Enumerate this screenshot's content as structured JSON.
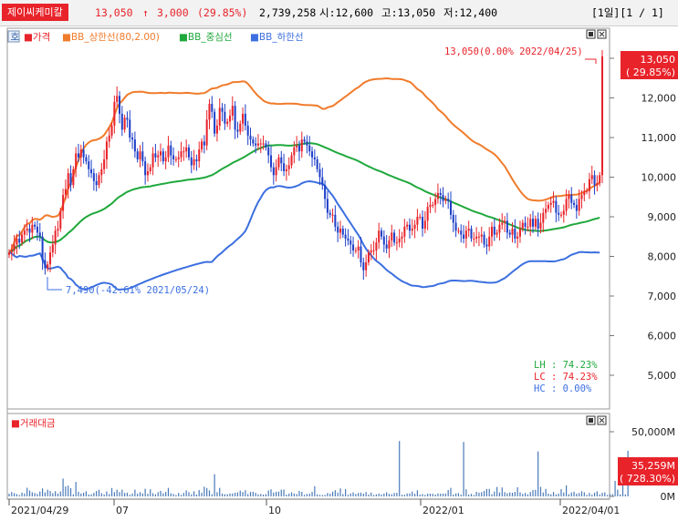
{
  "header": {
    "stock_name": "제이씨케미칼",
    "price": "13,050",
    "change_arrow": "↑",
    "change": "3,000",
    "change_pct": "(29.85%)",
    "volume": "2,739,258",
    "open": "시:12,600",
    "high": "고:13,050",
    "low": "저:12,400",
    "period": "[1일][1 / 1]"
  },
  "legend": {
    "price": "가격",
    "bb_upper": "BB_상한선(80,2.00)",
    "bb_mid": "BB_중심선",
    "bb_lower": "BB_하한선",
    "volume": "거래대금"
  },
  "badges": {
    "price_value": "13,050",
    "price_pct": "( 29.85%)",
    "volume_value": "35,259M",
    "volume_pct": "( 728.30%)"
  },
  "annotations": {
    "high": "13,050(0.00% 2022/04/25)",
    "low": "7,490(-42.61% 2021/05/24)",
    "lh": "LH : 74.23%",
    "lc": "LC : 74.23%",
    "hc": "HC : 0.00%"
  },
  "colors": {
    "up": "#e8232a",
    "down": "#1e3fc8",
    "bb_upper": "#f07b2b",
    "bb_mid": "#1fa83c",
    "bb_lower": "#3c6fe0",
    "volume": "#4a7ab8"
  },
  "chart_data": [
    {
      "type": "candlestick",
      "ylim": [
        4300,
        13500
      ],
      "y_ticks": [
        "13,000",
        "12,000",
        "11,000",
        "10,000",
        "9,000",
        "8,000",
        "7,000",
        "6,000",
        "5,000"
      ],
      "x_ticks": [
        "2021/04/29",
        "07",
        "10",
        "2022/01",
        "2022/04/01"
      ],
      "close": [
        8100,
        8150,
        8300,
        8450,
        8350,
        8550,
        8650,
        8700,
        8600,
        8800,
        8750,
        8600,
        8500,
        7900,
        7700,
        7800,
        8100,
        8300,
        8650,
        8700,
        9150,
        9550,
        9700,
        10100,
        9800,
        10200,
        10600,
        10500,
        10700,
        10500,
        10400,
        10200,
        10100,
        9900,
        9800,
        10050,
        10200,
        10450,
        10900,
        11050,
        11300,
        11900,
        12050,
        11600,
        11200,
        11500,
        11450,
        11000,
        10950,
        10650,
        10450,
        10650,
        10400,
        10050,
        10150,
        10250,
        10600,
        10500,
        10550,
        10650,
        10400,
        10500,
        10800,
        10550,
        10450,
        10450,
        10500,
        10650,
        10650,
        10750,
        10500,
        10300,
        10450,
        10400,
        10700,
        10900,
        10800,
        11450,
        11850,
        11650,
        11100,
        11300,
        11750,
        11650,
        11350,
        11400,
        11550,
        11800,
        11200,
        11150,
        11350,
        11600,
        11300,
        11050,
        10950,
        10850,
        10800,
        10850,
        10850,
        10850,
        10750,
        10550,
        10250,
        10050,
        10250,
        10500,
        10350,
        10150,
        10200,
        10300,
        10550,
        10750,
        10800,
        10650,
        10950,
        10900,
        10800,
        10650,
        10500,
        10450,
        10200,
        10000,
        9800,
        9450,
        9100,
        9050,
        9050,
        8750,
        8600,
        8700,
        8550,
        8450,
        8400,
        8300,
        8150,
        8150,
        8250,
        7850,
        7650,
        7850,
        8100,
        8150,
        8150,
        8350,
        8650,
        8500,
        8300,
        8200,
        8400,
        8600,
        8350,
        8350,
        8450,
        8500,
        8750,
        8800,
        8650,
        8700,
        8800,
        9000,
        9000,
        8700,
        8900,
        9250,
        9300,
        9300,
        9450,
        9600,
        9550,
        9400,
        9450,
        9400,
        9050,
        8850,
        8650,
        8650,
        8550,
        8450,
        8650,
        8700,
        8450,
        8450,
        8500,
        8500,
        8550,
        8300,
        8250,
        8500,
        8750,
        8550,
        8600,
        8800,
        8850,
        8900,
        8600,
        8550,
        8700,
        8450,
        8500,
        8700,
        8850,
        8750,
        8750,
        8950,
        8750,
        8950,
        8700,
        8850,
        9100,
        9200,
        9300,
        9350,
        9400,
        9100,
        9050,
        9050,
        9150,
        9450,
        9550,
        9350,
        9300,
        9150,
        9450,
        9550,
        9650,
        9650,
        9950,
        10050,
        9800,
        9850,
        10050,
        13050
      ],
      "high_label": "13,050",
      "low_label": "7,490"
    },
    {
      "type": "bar",
      "name": "거래대금",
      "y_ticks": [
        "50,000M",
        "0M"
      ],
      "ylim": [
        0,
        50000
      ],
      "values": [
        2100,
        3400,
        2500,
        1800,
        1100,
        2900,
        2300,
        6700,
        4600,
        3200,
        2700,
        1900,
        3800,
        6200,
        3100,
        5200,
        4200,
        2500,
        4000,
        2200,
        3800,
        13800,
        7700,
        8300,
        6400,
        1600,
        11200,
        3600,
        2300,
        2900,
        4000,
        1500,
        1600,
        2800,
        4200,
        5100,
        2500,
        1500,
        3800,
        1800,
        6500,
        3300,
        5200,
        3400,
        5200,
        2700,
        2900,
        1300,
        2200,
        5200,
        2100,
        3300,
        2300,
        5900,
        2000,
        5500,
        2500,
        1600,
        3300,
        4300,
        2400,
        3400,
        6600,
        2400,
        1900,
        1100,
        2700,
        1200,
        2700,
        4700,
        3300,
        1600,
        4000,
        1500,
        4900,
        2900,
        7500,
        6500,
        4700,
        1700,
        17200,
        3300,
        6600,
        2200,
        1700,
        1700,
        2300,
        2300,
        2800,
        3100,
        4500,
        3400,
        4800,
        1800,
        3400,
        3600,
        2800,
        1600,
        1900,
        1400,
        1700,
        4600,
        5500,
        3000,
        3600,
        3700,
        5200,
        5300,
        1500,
        2100,
        3200,
        2300,
        1800,
        4200,
        3500,
        1200,
        1900,
        2100,
        3500,
        7900,
        1600,
        1200,
        1100,
        1200,
        2600,
        2100,
        3700,
        4800,
        3000,
        6200,
        1800,
        5700,
        1200,
        2300,
        3100,
        1900,
        2700,
        2900,
        2100,
        3400,
        1500,
        3000,
        1100,
        1600,
        2200,
        1500,
        2200,
        3200,
        2000,
        1700,
        2600,
        2800,
        42800,
        1300,
        1300,
        2300,
        2400,
        3700,
        2000,
        4700,
        1400,
        1800,
        1200,
        2200,
        2100,
        2000,
        1400,
        2300,
        2100,
        2200,
        2200,
        4900,
        6600,
        1400,
        2300,
        2600,
        1400,
        42100,
        5500,
        1400,
        2000,
        1100,
        3500,
        2900,
        3300,
        4200,
        5700,
        5800,
        1700,
        3800,
        7300,
        3100,
        6900,
        3300,
        2400,
        3000,
        2800,
        3500,
        7100,
        3200,
        2000,
        2700,
        1600,
        3400,
        4900,
        5100,
        34800,
        7400,
        3100,
        5800,
        2100,
        1700,
        3400,
        1600,
        2200,
        5600,
        3000,
        8500,
        1700,
        3000,
        3600,
        2100,
        2600,
        4000,
        3200,
        1200,
        2700,
        1300,
        2900,
        3900,
        1500,
        2800,
        3200,
        1100,
        1800,
        1800,
        12000,
        5200,
        1600,
        8800,
        1600,
        35259
      ]
    }
  ]
}
